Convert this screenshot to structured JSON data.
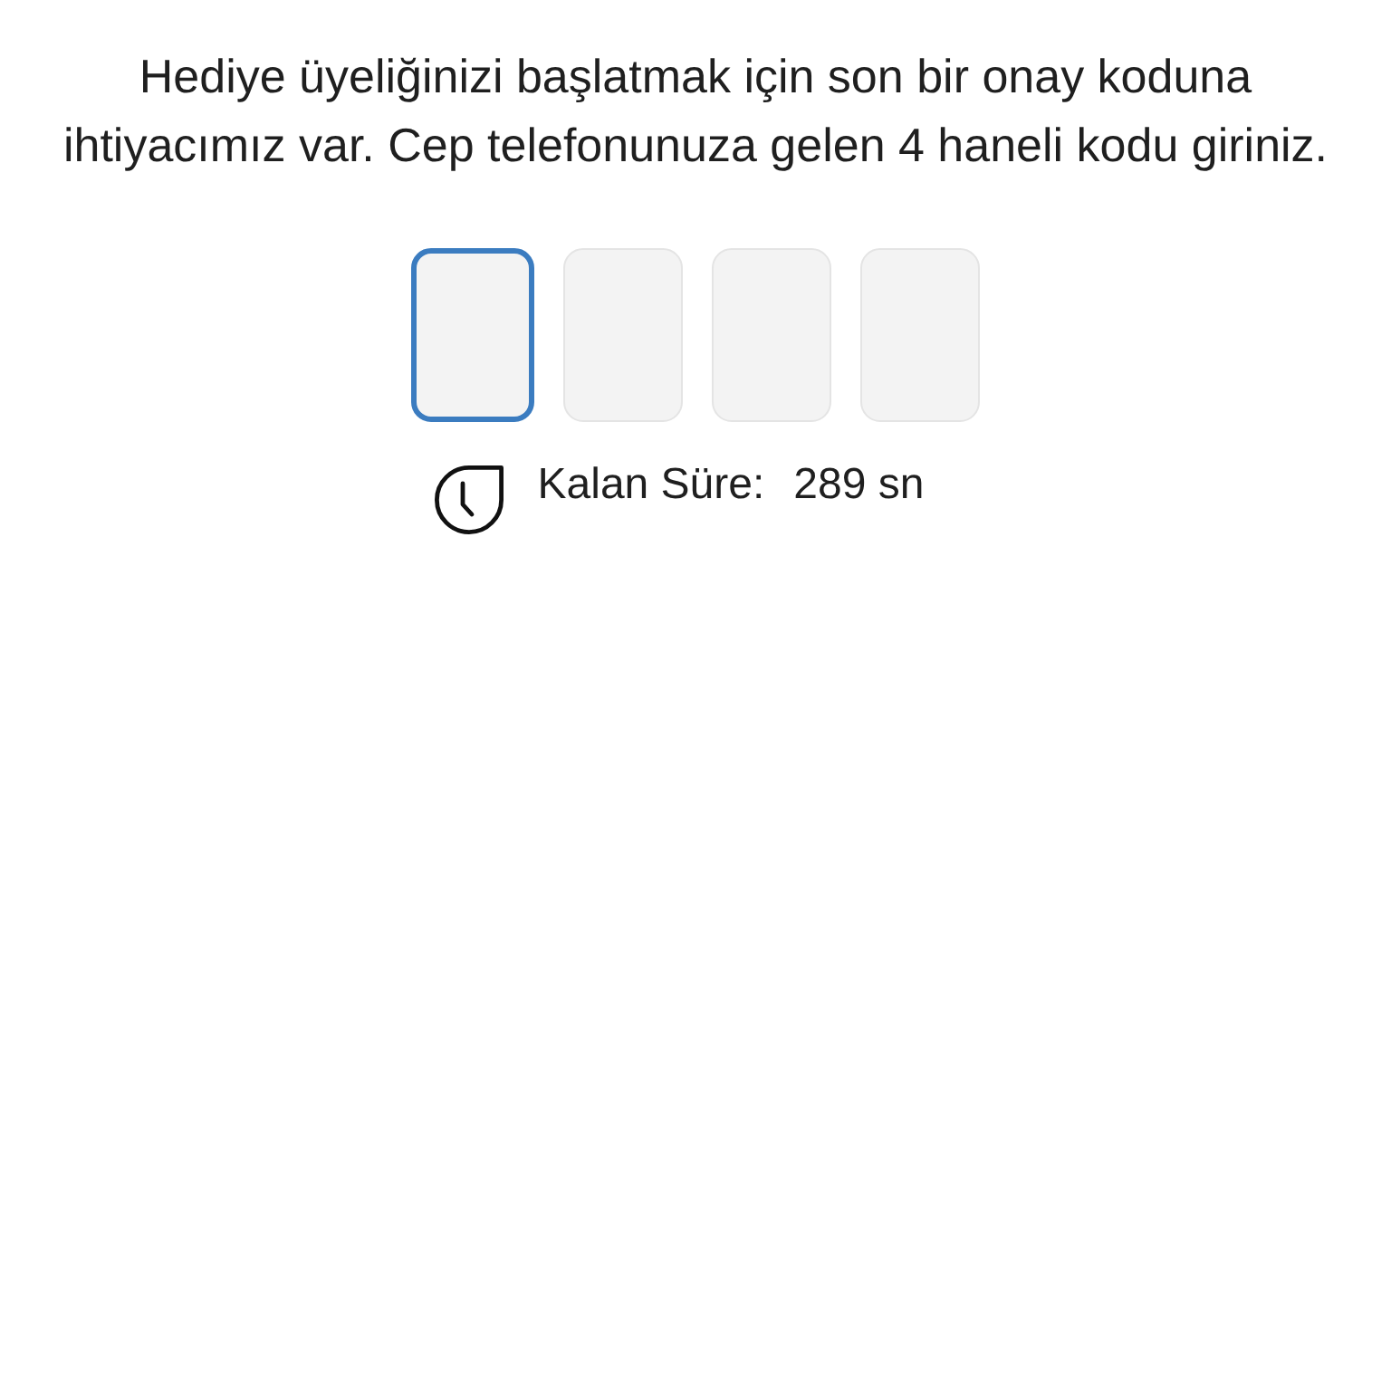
{
  "instruction": "Hediye üyeliğinizi başlatmak için son bir onay koduna ihtiyacımız var. Cep telefonunuza gelen 4 haneli kodu giriniz.",
  "code_inputs": [
    {
      "focused": true
    },
    {
      "focused": false
    },
    {
      "focused": false
    },
    {
      "focused": false
    }
  ],
  "timer": {
    "label": "Kalan Süre:",
    "value": "289 sn"
  }
}
